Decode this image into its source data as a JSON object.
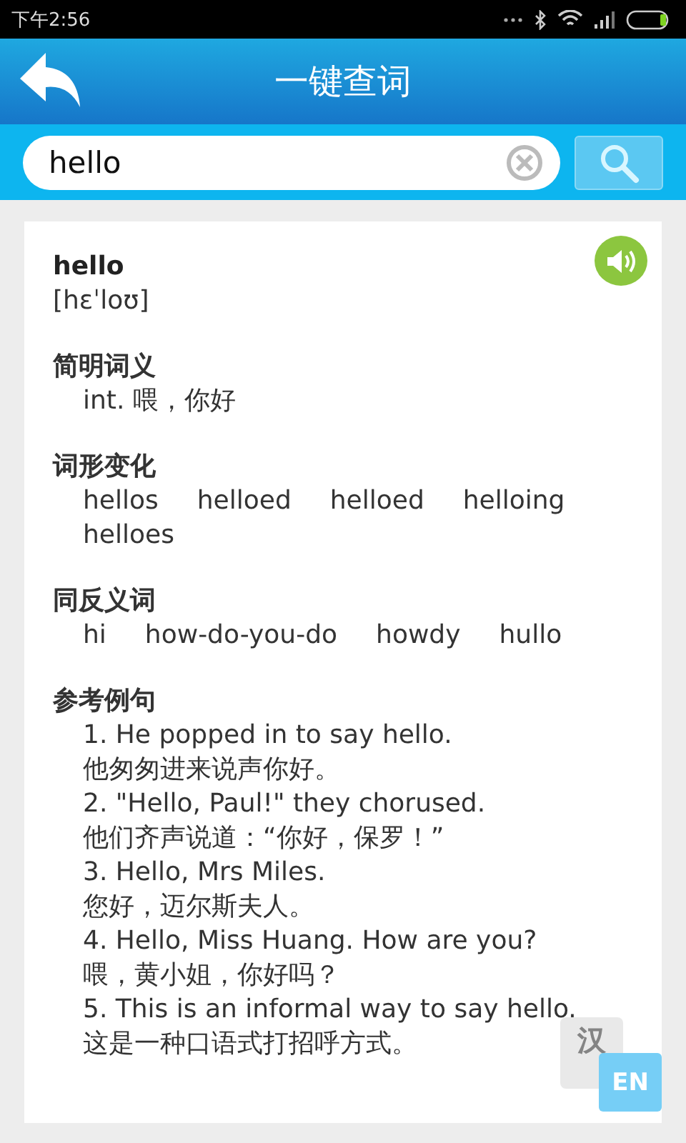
{
  "status_bar": {
    "time": "下午2:56"
  },
  "header": {
    "title": "一键查词"
  },
  "search": {
    "value": "hello"
  },
  "entry": {
    "word": "hello",
    "phonetic": "[hɛˈloʊ]",
    "sections": [
      {
        "kind": "lines",
        "title": "简明词义",
        "items": [
          "int. 喂，你好"
        ]
      },
      {
        "kind": "words",
        "title": "词形变化",
        "items": [
          "hellos",
          "helloed",
          "helloed",
          "helloing",
          "helloes"
        ]
      },
      {
        "kind": "words",
        "title": "同反义词",
        "items": [
          "hi",
          "how-do-you-do",
          "howdy",
          "hullo"
        ]
      },
      {
        "kind": "lines",
        "title": "参考例句",
        "items": [
          "1. He popped in to say hello.",
          "他匆匆进来说声你好。",
          "2. \"Hello, Paul!\" they chorused.",
          "他们齐声说道：“你好，保罗！”",
          "3. Hello, Mrs Miles.",
          "您好，迈尔斯夫人。",
          "4. Hello, Miss Huang. How are you?",
          "喂，黄小姐，你好吗？",
          "5. This is an informal way to say hello.",
          "这是一种口语式打招呼方式。"
        ]
      }
    ]
  },
  "overlay": {
    "source": "汉",
    "target": "EN"
  }
}
